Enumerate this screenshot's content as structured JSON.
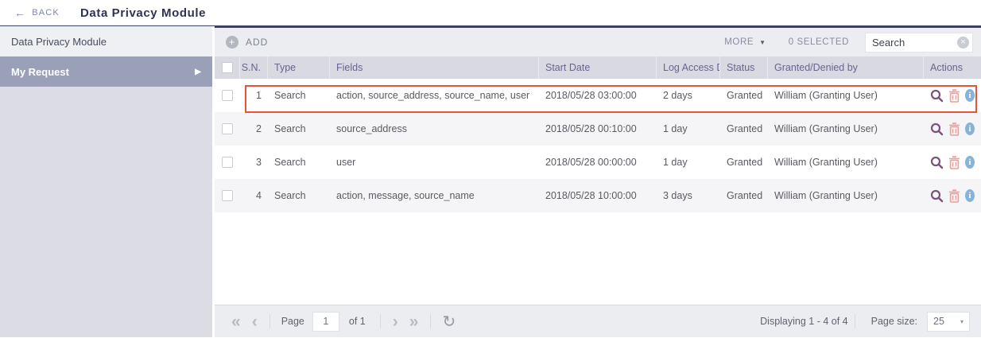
{
  "header": {
    "back_label": "BACK",
    "title": "Data Privacy Module"
  },
  "sidebar": {
    "items": [
      {
        "label": "Data Privacy Module",
        "selected": false
      },
      {
        "label": "My Request",
        "selected": true
      }
    ]
  },
  "toolbar": {
    "add_label": "ADD",
    "more_label": "MORE",
    "selected_count_label": "0 SELECTED",
    "search_placeholder": "Search"
  },
  "table": {
    "columns": {
      "sn": "S.N.",
      "type": "Type",
      "fields": "Fields",
      "start_date": "Start Date",
      "log_access_duration": "Log Access D",
      "status": "Status",
      "granted_by": "Granted/Denied by",
      "actions": "Actions"
    },
    "rows": [
      {
        "sn": "1",
        "type": "Search",
        "fields": "action, source_address, source_name, user",
        "start_date": "2018/05/28 03:00:00",
        "log_access_duration": "2 days",
        "status": "Granted",
        "granted_by": "William (Granting User)",
        "highlighted": true
      },
      {
        "sn": "2",
        "type": "Search",
        "fields": "source_address",
        "start_date": "2018/05/28 00:10:00",
        "log_access_duration": "1 day",
        "status": "Granted",
        "granted_by": "William (Granting User)",
        "highlighted": false
      },
      {
        "sn": "3",
        "type": "Search",
        "fields": "user",
        "start_date": "2018/05/28 00:00:00",
        "log_access_duration": "1 day",
        "status": "Granted",
        "granted_by": "William (Granting User)",
        "highlighted": false
      },
      {
        "sn": "4",
        "type": "Search",
        "fields": "action, message, source_name",
        "start_date": "2018/05/28 10:00:00",
        "log_access_duration": "3 days",
        "status": "Granted",
        "granted_by": "William (Granting User)",
        "highlighted": false
      }
    ]
  },
  "pagination": {
    "first_icon": "«",
    "prev_icon": "‹",
    "next_icon": "›",
    "last_icon": "»",
    "page_label": "Page",
    "page_value": "1",
    "of_label": "of 1",
    "displaying_text": "Displaying 1 - 4 of 4",
    "page_size_label": "Page size:",
    "page_size_value": "25"
  },
  "colors": {
    "accent_border": "#3c415a",
    "selected_item_bg": "#9aa0b8",
    "highlight_border": "#e8523c",
    "header_bg": "#d9dae1",
    "toolbar_bg": "#ecedf1",
    "search_icon_color": "#7b527b",
    "delete_icon_color": "#ee9e98",
    "info_icon_bg": "#85b3dc"
  }
}
